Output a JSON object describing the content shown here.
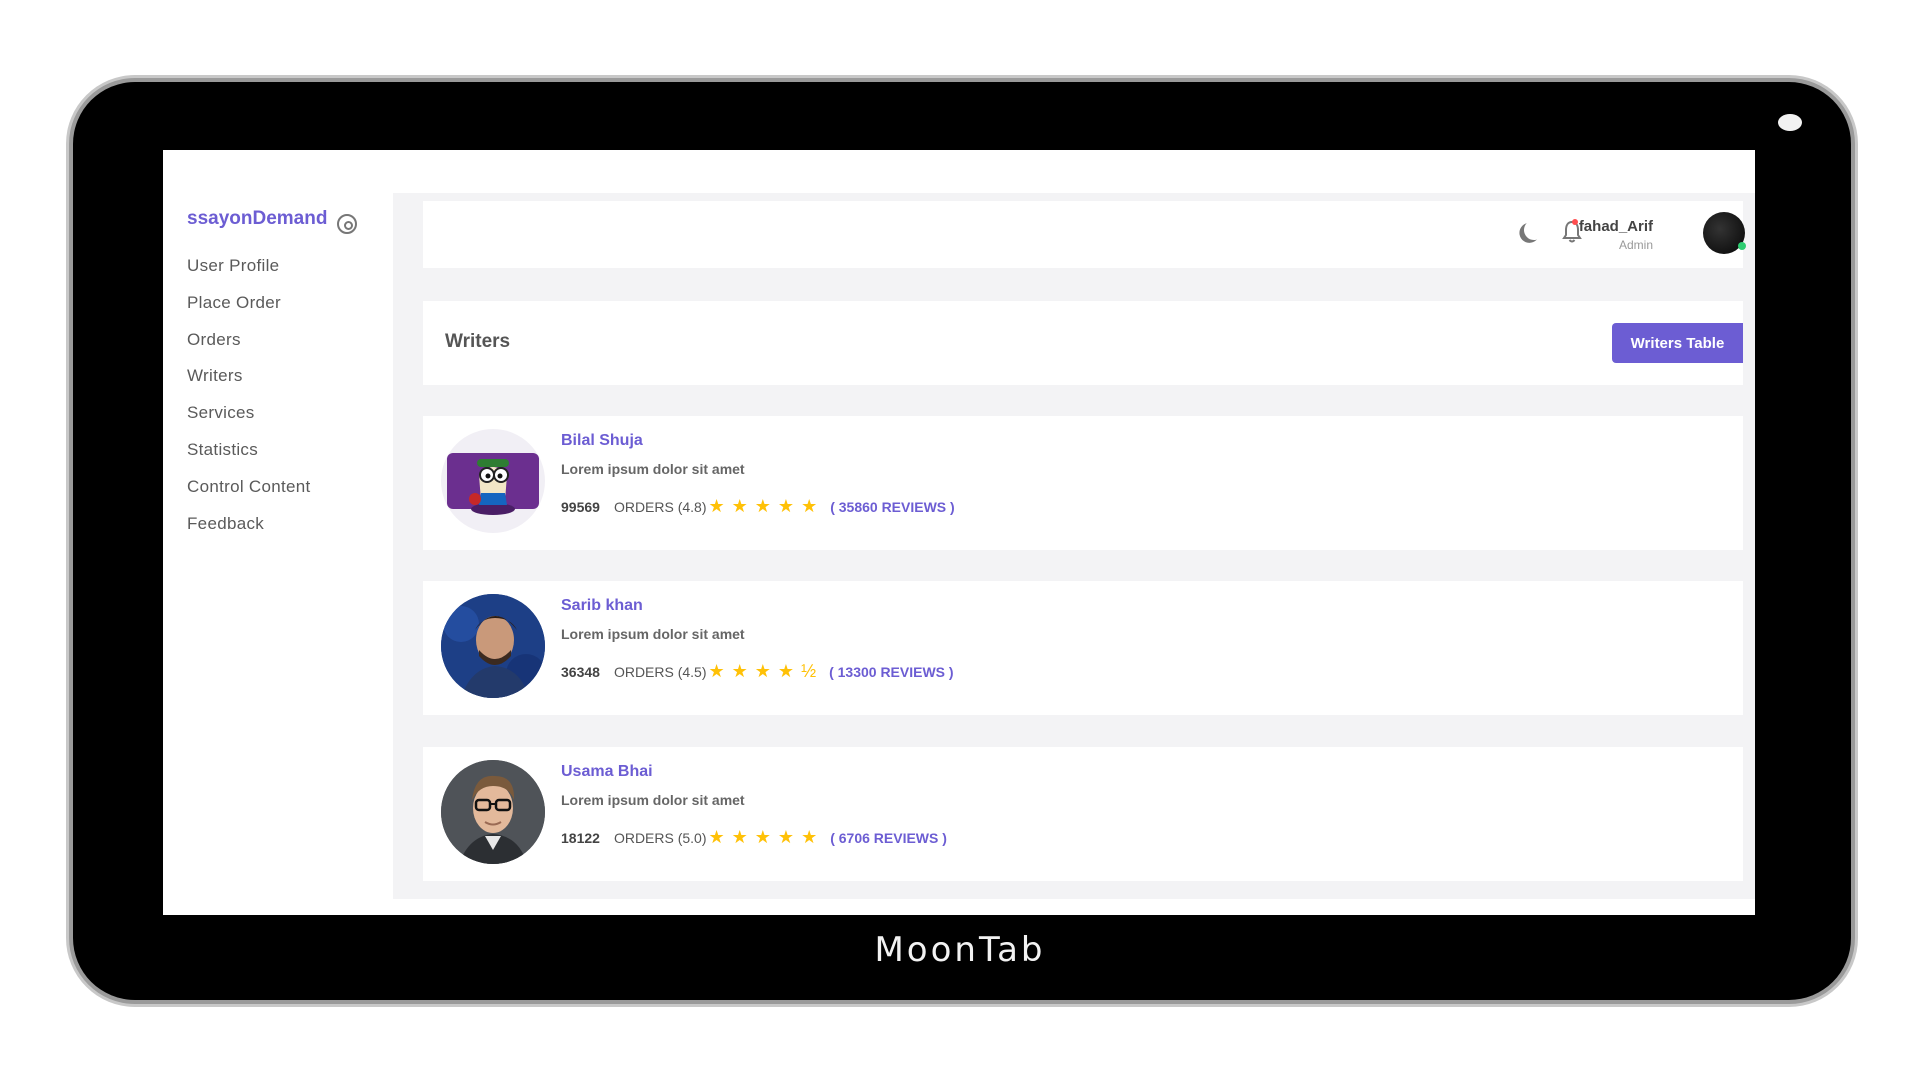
{
  "device": {
    "brand": "MoonTab"
  },
  "sidebar": {
    "logo": "ssayonDemand",
    "items": [
      {
        "label": "User Profile"
      },
      {
        "label": "Place Order"
      },
      {
        "label": "Orders"
      },
      {
        "label": "Writers"
      },
      {
        "label": "Services"
      },
      {
        "label": "Statistics"
      },
      {
        "label": "Control Content"
      },
      {
        "label": "Feedback"
      }
    ]
  },
  "topbar": {
    "user_name": "fahad_Arif",
    "user_role": "Admin"
  },
  "page": {
    "title": "Writers",
    "table_button": "Writers Table"
  },
  "writers": [
    {
      "name": "Bilal Shuja",
      "description": "Lorem ipsum dolor sit amet",
      "orders": "99569",
      "orders_label": "ORDERS (4.8)",
      "rating": 4.8,
      "stars": "★★★★★",
      "reviews": "( 35860 REVIEWS )"
    },
    {
      "name": "Sarib khan",
      "description": "Lorem ipsum dolor sit amet",
      "orders": "36348",
      "orders_label": "ORDERS (4.5)",
      "rating": 4.5,
      "stars": "★★★★½",
      "reviews": "( 13300 REVIEWS )"
    },
    {
      "name": "Usama Bhai",
      "description": "Lorem ipsum dolor sit amet",
      "orders": "18122",
      "orders_label": "ORDERS (5.0)",
      "rating": 5.0,
      "stars": "★★★★★",
      "reviews": "( 6706 REVIEWS )"
    }
  ],
  "colors": {
    "accent": "#6c5dd3",
    "star": "#ffc107",
    "background": "#f3f3f5"
  }
}
